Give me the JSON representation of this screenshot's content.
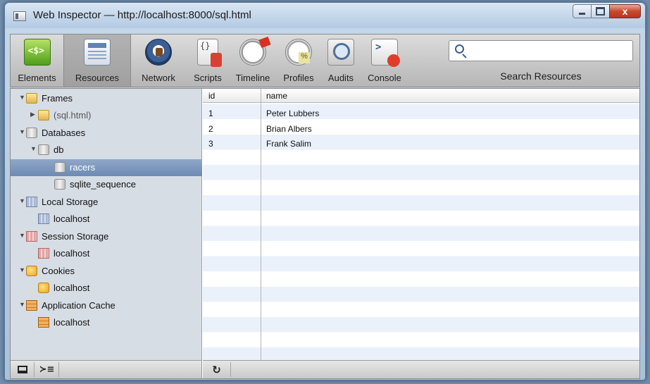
{
  "window": {
    "title": "Web Inspector — http://localhost:8000/sql.html",
    "controls": {
      "minimize": "",
      "maximize": "",
      "close": "x"
    }
  },
  "toolbar": {
    "tools": [
      {
        "label": "Elements",
        "icon": "elements-icon"
      },
      {
        "label": "Resources",
        "icon": "resources-icon"
      },
      {
        "label": "Network",
        "icon": "network-icon"
      },
      {
        "label": "Scripts",
        "icon": "scripts-icon"
      },
      {
        "label": "Timeline",
        "icon": "timeline-icon"
      },
      {
        "label": "Profiles",
        "icon": "profiles-icon"
      },
      {
        "label": "Audits",
        "icon": "audits-icon"
      },
      {
        "label": "Console",
        "icon": "console-icon"
      }
    ],
    "active_tool": "Resources",
    "search": {
      "value": "",
      "placeholder": "",
      "label": "Search Resources"
    }
  },
  "sidebar": {
    "tree": [
      {
        "label": "Frames",
        "icon": "folder-icon",
        "expanded": true
      },
      {
        "label": "(sql.html)",
        "icon": "folder-icon",
        "expanded": false
      },
      {
        "label": "Databases",
        "icon": "database-icon",
        "expanded": true
      },
      {
        "label": "db",
        "icon": "database-icon",
        "expanded": true
      },
      {
        "label": "racers",
        "icon": "database-icon",
        "selected": true
      },
      {
        "label": "sqlite_sequence",
        "icon": "database-icon"
      },
      {
        "label": "Local Storage",
        "icon": "local-storage-icon",
        "expanded": true
      },
      {
        "label": "localhost",
        "icon": "local-storage-icon"
      },
      {
        "label": "Session Storage",
        "icon": "session-storage-icon",
        "expanded": true
      },
      {
        "label": "localhost",
        "icon": "session-storage-icon"
      },
      {
        "label": "Cookies",
        "icon": "cookie-icon",
        "expanded": true
      },
      {
        "label": "localhost",
        "icon": "cookie-icon"
      },
      {
        "label": "Application Cache",
        "icon": "app-cache-icon",
        "expanded": true
      },
      {
        "label": "localhost",
        "icon": "app-cache-icon"
      }
    ]
  },
  "grid": {
    "columns": [
      "id",
      "name"
    ],
    "rows": [
      [
        "1",
        "Peter Lubbers"
      ],
      [
        "2",
        "Brian Albers"
      ],
      [
        "3",
        "Frank Salim"
      ]
    ]
  },
  "statusbar": {
    "dock_icon": "dock-icon",
    "console_icon": "console-drawer-icon",
    "refresh_icon": "refresh-icon",
    "console_glyph": "≻≡",
    "refresh_glyph": "↻"
  }
}
